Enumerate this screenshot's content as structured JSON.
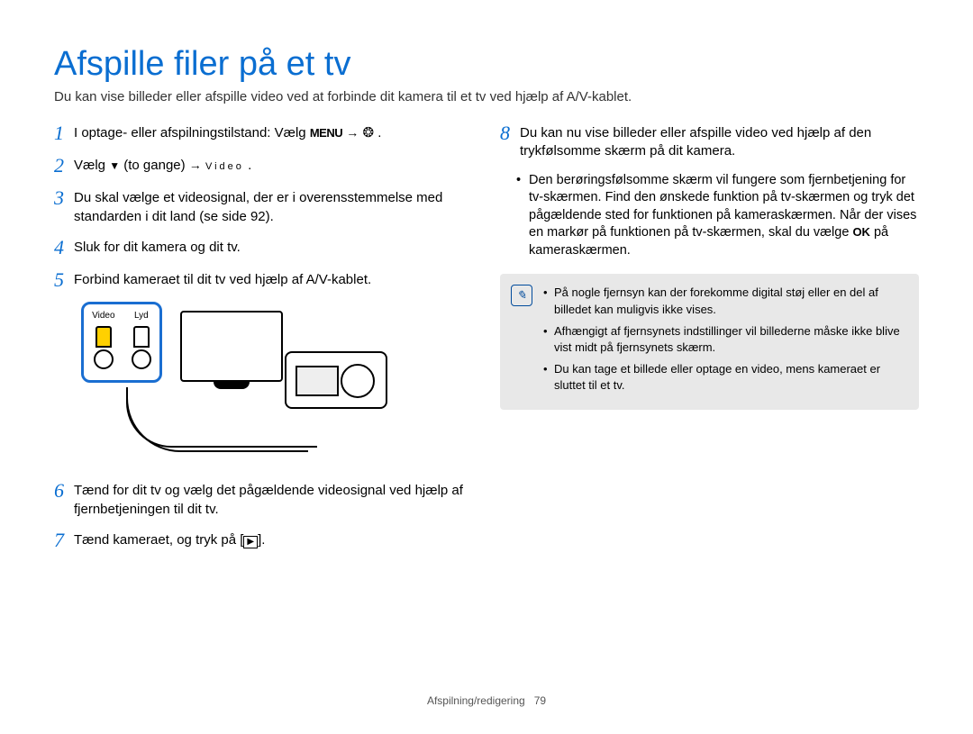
{
  "page": {
    "title": "Afspille filer på et tv",
    "subtitle": "Du kan vise billeder eller afspille video ved at forbinde dit kamera til et tv ved hjælp af A/V-kablet.",
    "footer_section": "Afspilning/redigering",
    "footer_page": "79"
  },
  "icons": {
    "menu": "MENU",
    "arrow": "→",
    "gear": "❂",
    "down": "▼",
    "ok": "OK",
    "play_box": "▶",
    "note": "✎"
  },
  "steps": {
    "s1_a": "I optage- eller afspilningstilstand: Vælg ",
    "s1_b": ".",
    "s2_a": "Vælg ",
    "s2_b": " (to gange) ",
    "s2_video": "Video",
    "s2_c": ".",
    "s3": "Du skal vælge et videosignal, der er i overensstemmelse med standarden i dit land (se side 92).",
    "s4": "Sluk for dit kamera og dit tv.",
    "s5": "Forbind kameraet til dit tv ved hjælp af A/V-kablet.",
    "s6": "Tænd for dit tv og vælg det pågældende videosignal ved hjælp af fjernbetjeningen til dit tv.",
    "s7_a": "Tænd kameraet, og tryk på [",
    "s7_b": "].",
    "s8": "Du kan nu vise billeder eller afspille video ved hjælp af den trykfølsomme skærm på dit kamera.",
    "s8_bullet_a": "Den berøringsfølsomme skærm vil fungere som fjernbetjening for tv-skærmen. Find den ønskede funktion på tv-skærmen og tryk det pågældende sted for funktionen på kameraskærmen. Når der vises en markør på funktionen på tv-skærmen, skal du vælge ",
    "s8_bullet_b": " på kameraskærmen."
  },
  "diagram": {
    "jack_video": "Video",
    "jack_audio": "Lyd"
  },
  "notes": {
    "n1": "På nogle fjernsyn kan der forekomme digital støj eller en del af billedet kan muligvis ikke vises.",
    "n2": "Afhængigt af fjernsynets indstillinger vil billederne måske ikke blive vist midt på fjernsynets skærm.",
    "n3": "Du kan tage et billede eller optage en video, mens kameraet er sluttet til et tv."
  }
}
